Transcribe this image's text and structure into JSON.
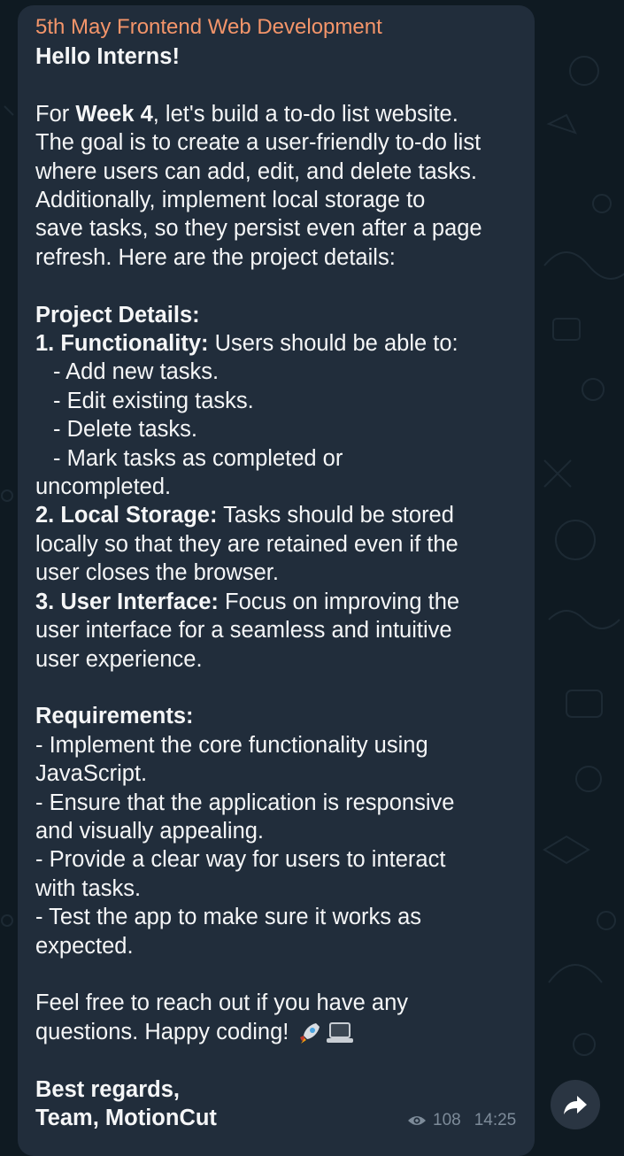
{
  "channel_name": "5th May Frontend Web Development",
  "message": {
    "greeting": "Hello Interns!",
    "intro_prefix": "For ",
    "intro_bold": "Week 4",
    "intro_line1_rest": ", let's build a to-do list website.",
    "intro_lines": [
      "The goal is to create a user-friendly to-do list",
      "where users can add, edit, and delete tasks.",
      "Additionally, implement local storage to",
      "save tasks, so they persist even after a page",
      "refresh. Here are the project details:"
    ],
    "details_heading": "Project Details:",
    "func_label": "1. Functionality:",
    "func_text": " Users should be able to:",
    "func_items": [
      "- Add new tasks.",
      "- Edit existing tasks.",
      "- Delete tasks.",
      "- Mark tasks as completed or"
    ],
    "func_wrap": "uncompleted.",
    "storage_label": "2. Local Storage:",
    "storage_text": " Tasks should be stored",
    "storage_lines": [
      "locally so that they are retained even if the",
      "user closes the browser."
    ],
    "ui_label": "3. User Interface:",
    "ui_text": " Focus on improving the",
    "ui_lines": [
      "user interface for a seamless and intuitive",
      "user experience."
    ],
    "req_heading": "Requirements:",
    "req_lines": [
      "- Implement the core functionality using",
      "JavaScript.",
      "- Ensure that the application is responsive",
      "and visually appealing.",
      "- Provide a clear way for users to interact",
      "with tasks.",
      "- Test the app to make sure it works as",
      "expected."
    ],
    "closing_line1": "Feel free to reach out if you have any",
    "closing_line2": "questions. Happy coding!",
    "emojis": [
      "rocket-emoji",
      "laptop-emoji"
    ],
    "signoff_1": "Best regards,",
    "signoff_2": "Team, MotionCut"
  },
  "meta": {
    "views": "108",
    "time": "14:25"
  },
  "colors": {
    "bubble": "#212d3b",
    "channel_name": "#f4956a",
    "text": "#f5f6f7",
    "meta": "#7d8b99",
    "background": "#0f1a22"
  }
}
